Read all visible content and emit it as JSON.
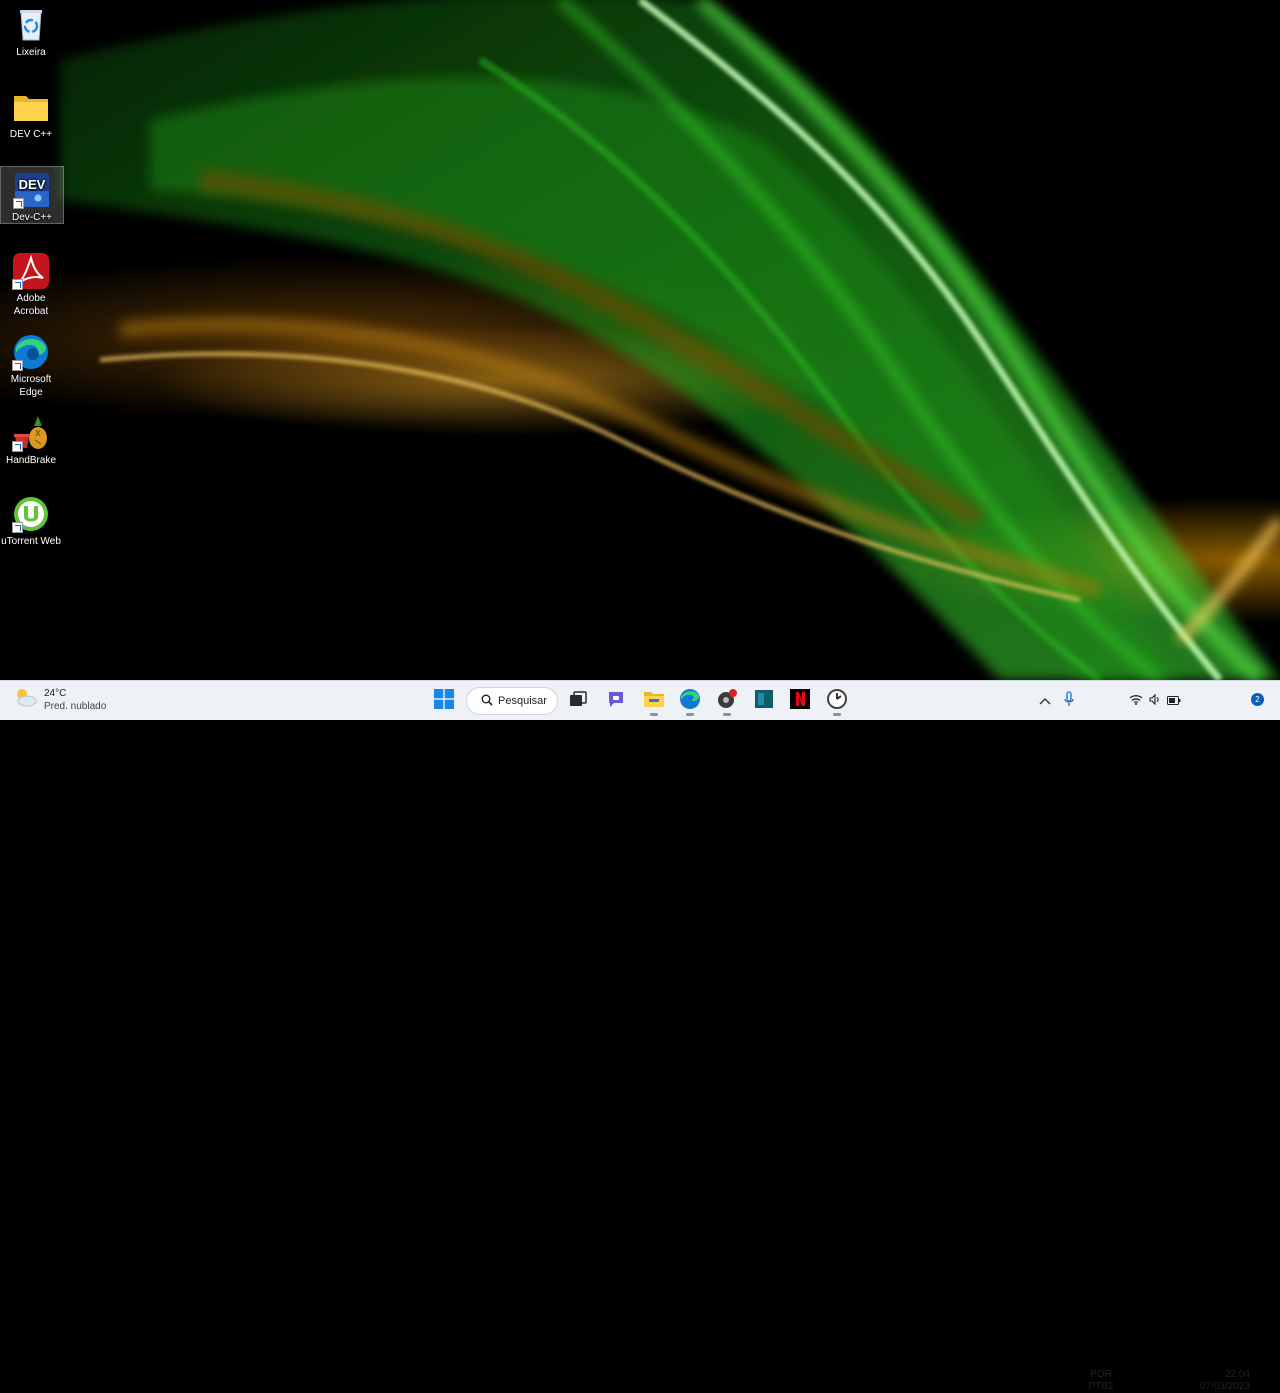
{
  "desktop": {
    "icons": [
      {
        "label": "Lixeira",
        "icon": "recycle-bin-icon"
      },
      {
        "label": "DEV C++",
        "icon": "folder-icon"
      },
      {
        "label": "Dev-C++",
        "icon": "dev-cpp-icon",
        "badge_text": "DEV"
      },
      {
        "label_line1": "Adobe",
        "label_line2": "Acrobat",
        "icon": "adobe-acrobat-icon"
      },
      {
        "label_line1": "Microsoft",
        "label_line2": "Edge",
        "icon": "edge-icon"
      },
      {
        "label": "HandBrake",
        "icon": "handbrake-icon"
      },
      {
        "label": "uTorrent Web",
        "icon": "utorrent-icon"
      }
    ]
  },
  "taskbar": {
    "weather": {
      "temp": "24°C",
      "condition": "Pred. nublado",
      "icon": "partly-cloudy-icon"
    },
    "search_label": "Pesquisar",
    "apps": [
      "start-icon",
      "task-view-icon",
      "teams-chat-icon",
      "file-explorer-icon",
      "edge-icon",
      "recording-app-icon",
      "ide-app-icon",
      "netflix-icon",
      "clock-app-icon"
    ],
    "tray": {
      "lang_line1": "POR",
      "lang_line2": "PTB2",
      "time": "22:04",
      "date": "07/03/2023",
      "notifications": "2"
    }
  },
  "colors": {
    "taskbar_bg": "#eef1f6",
    "wallpaper_green": "#2fd02a",
    "wallpaper_gold": "#e0a020",
    "accent_blue": "#0a5fb8"
  }
}
